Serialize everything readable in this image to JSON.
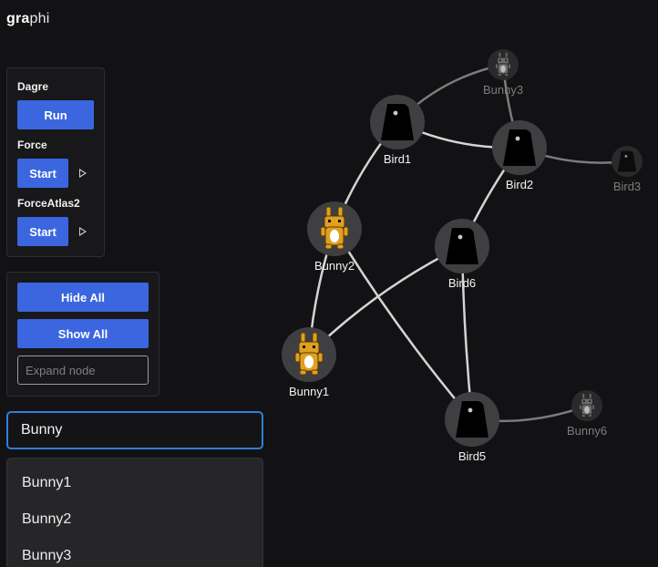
{
  "app": {
    "logo_bold": "gra",
    "logo_rest": "phi"
  },
  "layout_panel": {
    "dagre_label": "Dagre",
    "dagre_button": "Run",
    "force_label": "Force",
    "force_button": "Start",
    "forceatlas_label": "ForceAtlas2",
    "forceatlas_button": "Start",
    "play_icon": "play-icon"
  },
  "node_panel": {
    "hide_all": "Hide All",
    "show_all": "Show All",
    "expand_placeholder": "Expand node"
  },
  "search": {
    "value": "Bunny",
    "results": [
      "Bunny1",
      "Bunny2",
      "Bunny3"
    ]
  },
  "graph": {
    "colors": {
      "edge": "#d4d4d4",
      "edge_faded": "#7c7c7c",
      "node": "#3f3f42",
      "node_faded": "#2a2a2c",
      "label": "#f2f2f2",
      "label_faded": "#7d7d7d",
      "bunny": "#e0a020",
      "bird": "#000000"
    },
    "nodes": [
      {
        "id": "bird1",
        "label": "Bird1",
        "kind": "bird",
        "faded": false
      },
      {
        "id": "bird2",
        "label": "Bird2",
        "kind": "bird",
        "faded": false
      },
      {
        "id": "bird3",
        "label": "Bird3",
        "kind": "bird",
        "faded": true
      },
      {
        "id": "bird5",
        "label": "Bird5",
        "kind": "bird",
        "faded": false
      },
      {
        "id": "bird6",
        "label": "Bird6",
        "kind": "bird",
        "faded": false
      },
      {
        "id": "bunny1",
        "label": "Bunny1",
        "kind": "bunny",
        "faded": false
      },
      {
        "id": "bunny2",
        "label": "Bunny2",
        "kind": "bunny",
        "faded": false
      },
      {
        "id": "bunny3",
        "label": "Bunny3",
        "kind": "bunny",
        "faded": true
      },
      {
        "id": "bunny6",
        "label": "Bunny6",
        "kind": "bunny",
        "faded": true
      }
    ],
    "edges": [
      {
        "from": "bunny3",
        "to": "bird1",
        "faded": true
      },
      {
        "from": "bunny3",
        "to": "bird2",
        "faded": true
      },
      {
        "from": "bird1",
        "to": "bird2",
        "faded": false
      },
      {
        "from": "bird2",
        "to": "bird3",
        "faded": true
      },
      {
        "from": "bird1",
        "to": "bunny2",
        "faded": false
      },
      {
        "from": "bird2",
        "to": "bird6",
        "faded": false
      },
      {
        "from": "bunny2",
        "to": "bunny1",
        "faded": false
      },
      {
        "from": "bunny2",
        "to": "bird5",
        "faded": false
      },
      {
        "from": "bunny1",
        "to": "bird6",
        "faded": false
      },
      {
        "from": "bird6",
        "to": "bird5",
        "faded": false
      },
      {
        "from": "bird5",
        "to": "bunny6",
        "faded": true
      }
    ]
  }
}
